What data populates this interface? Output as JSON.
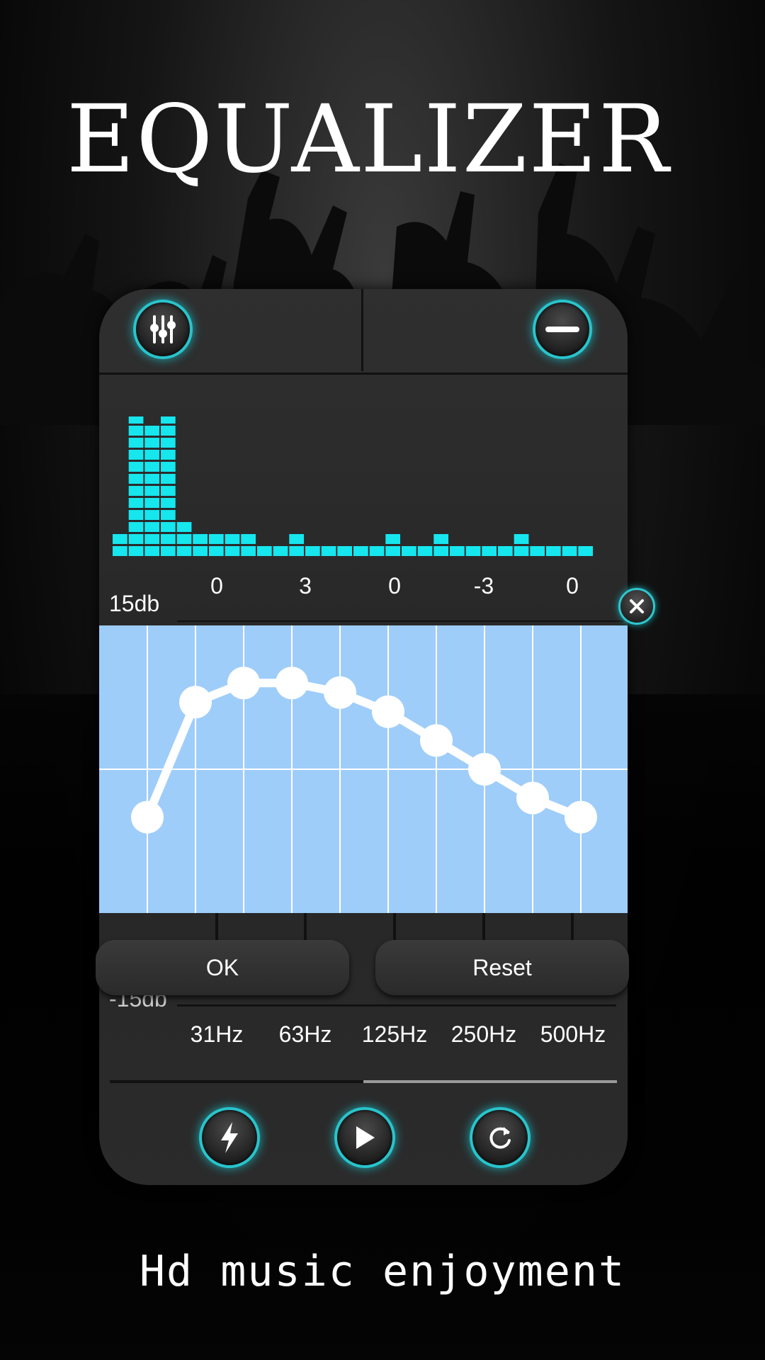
{
  "title": "EQUALIZER",
  "tagline": "Hd music enjoyment",
  "colors": {
    "accent": "#29c4cc",
    "spectrum": "#16e6ee",
    "graph_bg": "#9ecdfa",
    "panel": "#2a2a2a"
  },
  "header": {
    "left_icon": "sliders-icon",
    "right_icon": "minus-icon"
  },
  "spectrum": {
    "levels": [
      2,
      12,
      11,
      12,
      3,
      2,
      2,
      2,
      2,
      1,
      1,
      2,
      1,
      1,
      1,
      1,
      1,
      2,
      1,
      1,
      2,
      1,
      1,
      1,
      1,
      2,
      1,
      1,
      1,
      1
    ]
  },
  "eq": {
    "top_label": "15db",
    "bottom_label": "-15db",
    "values": [
      "0",
      "3",
      "0",
      "-3",
      "0"
    ],
    "frequencies": [
      "31Hz",
      "63Hz",
      "125Hz",
      "250Hz",
      "500Hz"
    ]
  },
  "dialog": {
    "ok_label": "OK",
    "reset_label": "Reset",
    "close_icon": "close-icon"
  },
  "curve_points": [
    -5,
    7,
    9,
    9,
    8,
    6,
    3,
    0,
    -3,
    -5
  ],
  "progress": 0.5,
  "bottom_buttons": [
    "flash-icon",
    "play-icon",
    "refresh-icon"
  ]
}
